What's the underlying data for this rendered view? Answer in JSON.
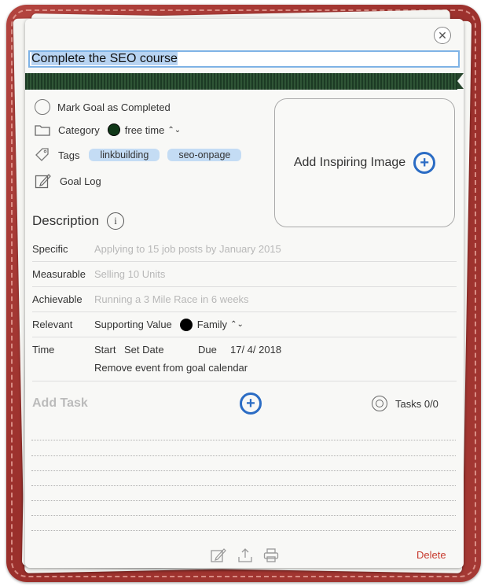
{
  "goal": {
    "title": "Complete the SEO course",
    "mark_completed_label": "Mark Goal as Completed",
    "category_label": "Category",
    "category_value": "free time",
    "category_color": "#103818",
    "tags_label": "Tags",
    "tags": [
      "linkbuilding",
      "seo-onpage"
    ],
    "goal_log_label": "Goal Log",
    "add_image_label": "Add Inspiring Image"
  },
  "description": {
    "title": "Description",
    "specific_label": "Specific",
    "specific_placeholder": "Applying to 15 job posts by January 2015",
    "measurable_label": "Measurable",
    "measurable_placeholder": "Selling 10 Units",
    "achievable_label": "Achievable",
    "achievable_placeholder": "Running a 3 Mile Race in 6 weeks",
    "relevant_label": "Relevant",
    "relevant_text": "Supporting Value",
    "relevant_value": "Family",
    "time_label": "Time",
    "start_label": "Start",
    "start_value": "Set Date",
    "due_label": "Due",
    "due_value": "17/ 4/ 2018",
    "remove_event_label": "Remove event from goal calendar"
  },
  "tasks": {
    "add_label": "Add Task",
    "count_label": "Tasks 0/0"
  },
  "footer": {
    "delete_label": "Delete"
  },
  "icons": {
    "close": "close-icon",
    "category": "folder-icon",
    "tags": "tag-icon",
    "log": "edit-icon",
    "info": "info-icon",
    "target": "target-icon",
    "share": "share-icon",
    "print": "print-icon"
  },
  "colors": {
    "accent": "#2b6cc4",
    "delete": "#c73a2e",
    "frame": "#a53934"
  }
}
